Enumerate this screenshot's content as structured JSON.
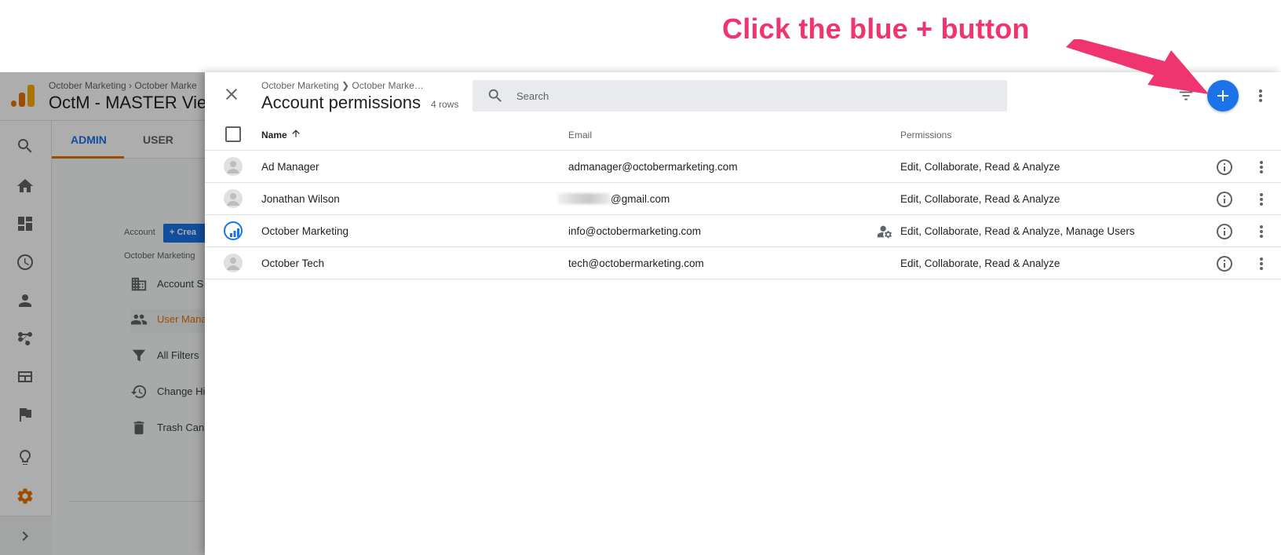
{
  "annotation": {
    "text": "Click the blue + button"
  },
  "background": {
    "breadcrumb": "October Marketing  ›  October Marke",
    "title": "OctM - MASTER Vie",
    "tabs": [
      {
        "label": "ADMIN"
      },
      {
        "label": "USER"
      }
    ],
    "account_label": "Account",
    "create_label": "+  Crea",
    "account_name": "October Marketing",
    "nav": [
      {
        "label": "Account S",
        "icon": "building-icon"
      },
      {
        "label": "User Mana",
        "icon": "users-icon"
      },
      {
        "label": "All Filters",
        "icon": "filter-icon"
      },
      {
        "label": "Change Hi",
        "icon": "history-icon"
      },
      {
        "label": "Trash Can",
        "icon": "trash-icon"
      }
    ]
  },
  "drawer": {
    "breadcrumb": "October Marketing ❯ October Marke…",
    "title": "Account permissions",
    "row_count": "4 rows",
    "search_placeholder": "Search",
    "columns": {
      "name": "Name",
      "email": "Email",
      "permissions": "Permissions"
    },
    "rows": [
      {
        "name": "Ad Manager",
        "email": "admanager@octobermarketing.com",
        "permissions": "Edit, Collaborate, Read & Analyze",
        "avatar": "default-avatar-icon"
      },
      {
        "name": "Jonathan Wilson",
        "email": "@gmail.com",
        "permissions": "Edit, Collaborate, Read & Analyze",
        "avatar": "default-avatar-icon"
      },
      {
        "name": "October Marketing",
        "email": "info@octobermarketing.com",
        "permissions": "Edit, Collaborate, Read & Analyze, Manage Users",
        "avatar": "analytics-logo-icon"
      },
      {
        "name": "October Tech",
        "email": "tech@octobermarketing.com",
        "permissions": "Edit, Collaborate, Read & Analyze",
        "avatar": "default-avatar-icon"
      }
    ]
  },
  "colors": {
    "accent": "#1a73e8",
    "annotation": "#f0346f",
    "ga_orange": "#e37400"
  }
}
